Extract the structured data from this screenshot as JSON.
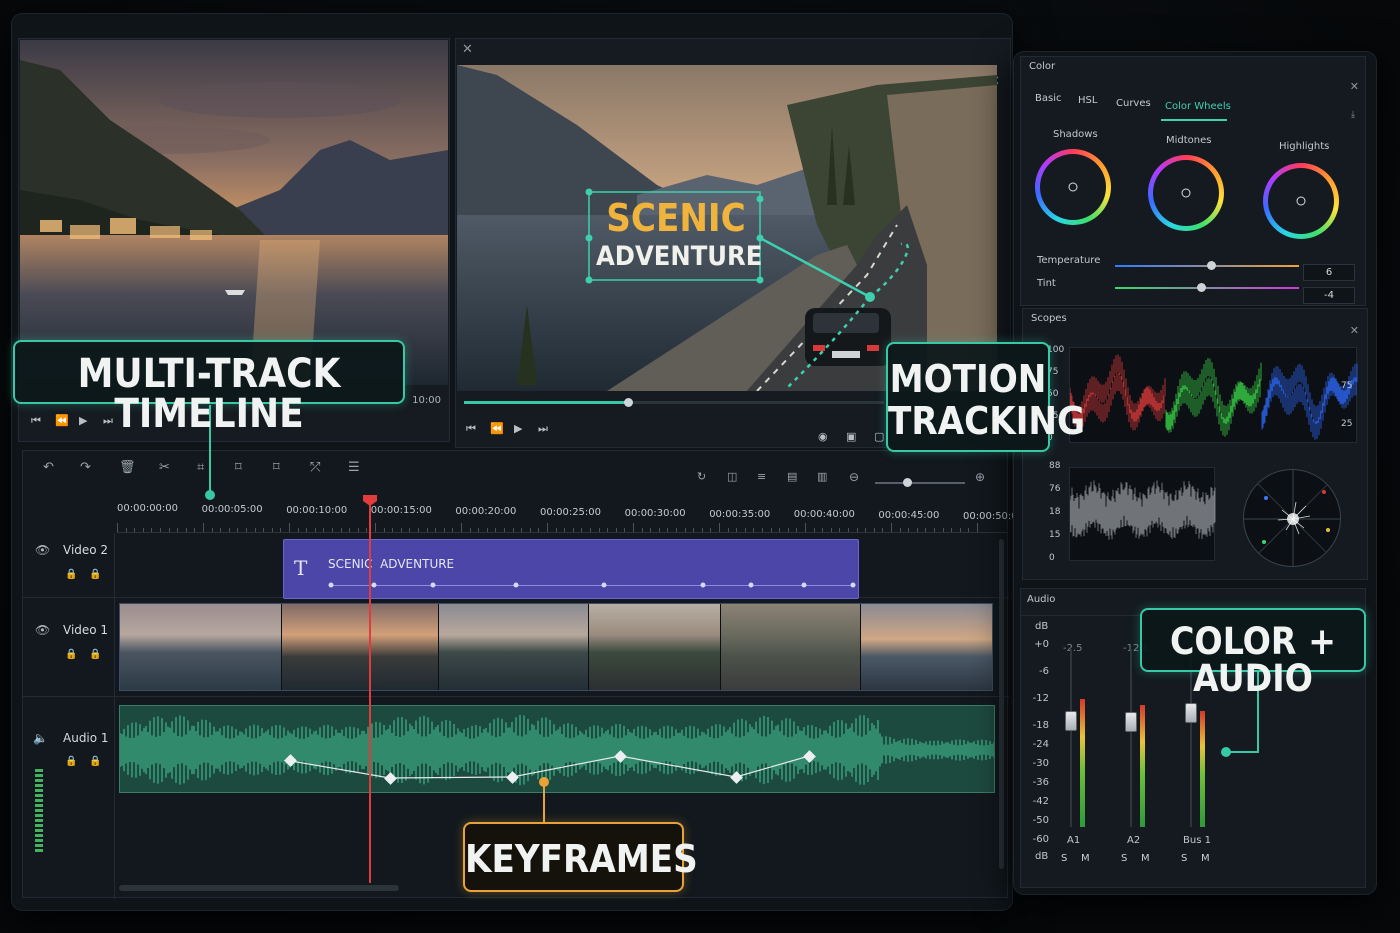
{
  "viewer_left": {
    "timecode": "10:00"
  },
  "viewer_right": {
    "title_line1": "SCENIC",
    "title_line2": "ADVENTURE",
    "progress": 0.39
  },
  "timeline": {
    "ruler": [
      "00:00:00:00",
      "00:00:05:00",
      "00:00:10:00",
      "00:00:15:00",
      "00:00:20:00",
      "00:00:25:00",
      "00:00:30:00",
      "00:00:35:00",
      "00:00:40:00",
      "00:00:45:00",
      "00:00:50:0"
    ],
    "tracks": [
      {
        "name": "Video 2"
      },
      {
        "name": "Video 1"
      },
      {
        "name": "Audio 1"
      }
    ],
    "title_clip": {
      "icon": "T",
      "text": "SCENIC  ADVENTURE"
    }
  },
  "color_panel": {
    "title": "Color",
    "tabs": [
      "Basic",
      "HSL",
      "Curves",
      "Color Wheels"
    ],
    "active_tab": "Color Wheels",
    "wheels": [
      "Shadows",
      "Midtones",
      "Highlights"
    ],
    "temperature": {
      "label": "Temperature",
      "value": "6",
      "position": 0.52
    },
    "tint": {
      "label": "Tint",
      "value": "-4",
      "position": 0.47
    }
  },
  "scopes_panel": {
    "title": "Scopes",
    "parade_ticks": [
      "100",
      "75",
      "50",
      "25",
      "0"
    ],
    "parade_ticks_right": [
      "75",
      "25"
    ],
    "wave_ticks": [
      "88",
      "76",
      "18",
      "15",
      "0"
    ]
  },
  "audio_panel": {
    "title": "Audio",
    "db_label": "dB",
    "scale": [
      "+0",
      "-6",
      "-12",
      "-18",
      "-24",
      "-30",
      "-36",
      "-42",
      "-50",
      "-60"
    ],
    "peak_values": [
      "-2.5",
      "-12.1"
    ],
    "channels": [
      {
        "name": "A1",
        "fader": 0.62
      },
      {
        "name": "A2",
        "fader": 0.6
      },
      {
        "name": "Bus 1",
        "fader": 0.74
      }
    ],
    "solo": "S",
    "mute": "M",
    "bottom_db": "dB"
  },
  "callouts": {
    "timeline": "MULTI-TRACK TIMELINE",
    "motion_1": "MOTION",
    "motion_2": "TRACKING",
    "color_audio": "COLOR + AUDIO",
    "keyframes": "KEYFRAMES"
  },
  "colors": {
    "accent_teal": "#37c9a6",
    "accent_orange": "#e9a237",
    "title_clip": "#4b46a8",
    "audio_wave": "#3fb58a",
    "playhead": "#e23b3b"
  }
}
